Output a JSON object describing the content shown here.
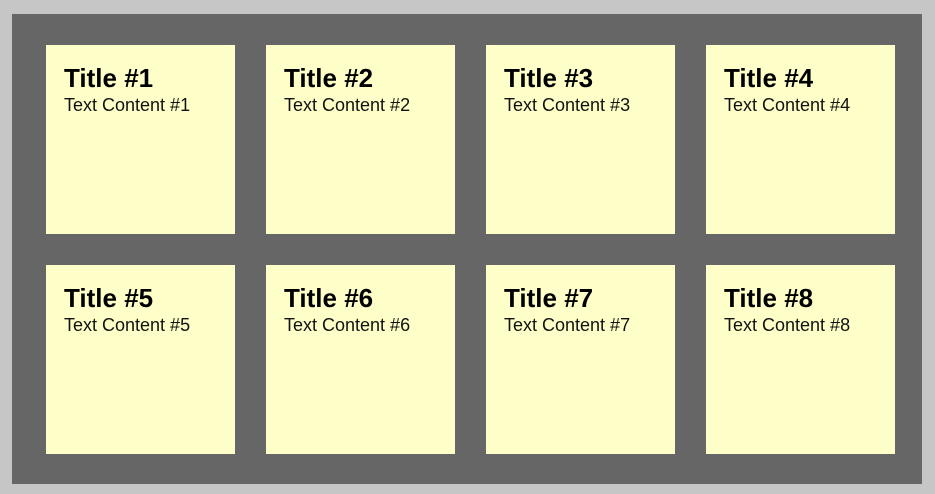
{
  "notes": [
    {
      "title": "Title #1",
      "text": "Text Content #1"
    },
    {
      "title": "Title #2",
      "text": "Text Content #2"
    },
    {
      "title": "Title #3",
      "text": "Text Content #3"
    },
    {
      "title": "Title #4",
      "text": "Text Content #4"
    },
    {
      "title": "Title #5",
      "text": "Text Content #5"
    },
    {
      "title": "Title #6",
      "text": "Text Content #6"
    },
    {
      "title": "Title #7",
      "text": "Text Content #7"
    },
    {
      "title": "Title #8",
      "text": "Text Content #8"
    }
  ],
  "colors": {
    "page_border": "#c6c6c6",
    "board": "#666666",
    "note": "#fefec8"
  }
}
